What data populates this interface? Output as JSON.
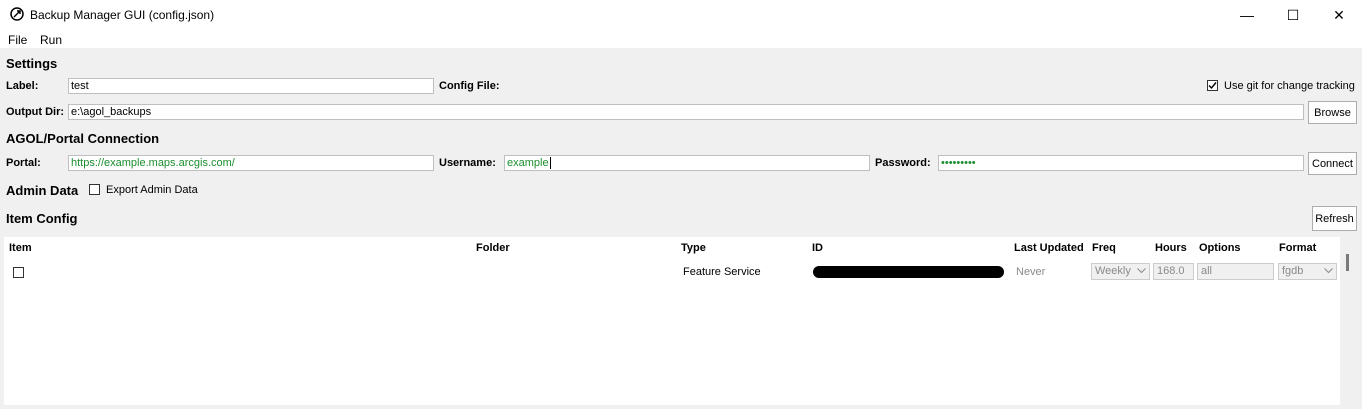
{
  "window": {
    "title": "Backup Manager GUI (config.json)",
    "minimize": "—",
    "maximize": "☐",
    "close": "✕"
  },
  "menu": {
    "file": "File",
    "run": "Run"
  },
  "settings": {
    "heading": "Settings",
    "label_label": "Label:",
    "label_value": "test",
    "config_file_label": "Config File:",
    "git_label": "Use git for change tracking",
    "git_checked": true,
    "output_dir_label": "Output Dir:",
    "output_dir_value": "e:\\agol_backups",
    "browse": "Browse"
  },
  "connection": {
    "heading": "AGOL/Portal Connection",
    "portal_label": "Portal:",
    "portal_value": "https://example.maps.arcgis.com/",
    "username_label": "Username:",
    "username_value": "example",
    "password_label": "Password:",
    "password_value": "•••••••••",
    "connect": "Connect"
  },
  "admin": {
    "heading": "Admin Data",
    "export_label": "Export Admin Data",
    "export_checked": false
  },
  "items": {
    "heading": "Item Config",
    "refresh": "Refresh",
    "columns": {
      "item": "Item",
      "folder": "Folder",
      "type": "Type",
      "id": "ID",
      "last_updated": "Last Updated",
      "freq": "Freq",
      "hours": "Hours",
      "options": "Options",
      "format": "Format"
    },
    "rows": [
      {
        "checked": false,
        "item": "",
        "folder": "",
        "type": "Feature Service",
        "id": "",
        "last_updated": "Never",
        "freq": "Weekly",
        "hours": "168.0",
        "options": "all",
        "format": "fgdb"
      }
    ]
  }
}
